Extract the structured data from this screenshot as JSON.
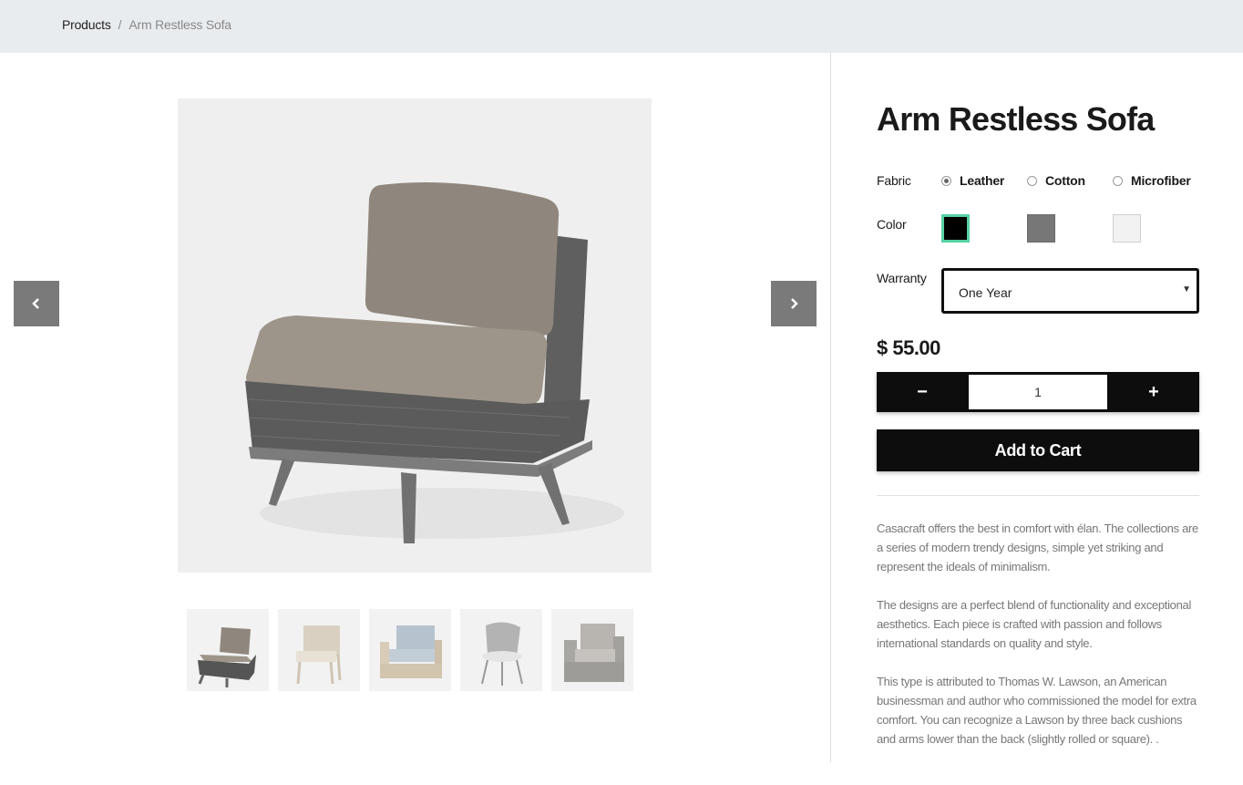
{
  "breadcrumb": {
    "parent": "Products",
    "separator": "/",
    "current": "Arm Restless Sofa"
  },
  "product": {
    "title": "Arm Restless Sofa",
    "fabric_label": "Fabric",
    "fabrics": [
      "Leather",
      "Cotton",
      "Microfiber"
    ],
    "selected_fabric": "Leather",
    "color_label": "Color",
    "colors": [
      "#000000",
      "#777777",
      "#f2f2f2"
    ],
    "selected_color": "#000000",
    "warranty_label": "Warranty",
    "warranty_value": "One Year",
    "price": "$ 55.00",
    "quantity": "1",
    "qty_minus": "−",
    "qty_plus": "+",
    "add_to_cart": "Add to Cart"
  },
  "gallery": {
    "main_image": "gray wicker armless sofa chair with taupe cushions",
    "thumbnails": [
      "gray wicker sofa chair",
      "beige wooden dining chair",
      "light wood armchair with blue cushions",
      "gray wicker lounge chair",
      "gray wicker club chair"
    ]
  },
  "description": [
    "Casacraft offers the best in comfort with élan. The collections are a series of modern trendy designs, simple yet striking and represent the ideals of minimalism.",
    "The designs are a perfect blend of functionality and exceptional aesthetics. Each piece is crafted with passion and follows international standards on quality and style.",
    "This type is attributed to Thomas W. Lawson, an American businessman and author who commissioned the model for extra comfort. You can recognize a Lawson by three back cushions and arms lower than the back (slightly rolled or square). ."
  ],
  "colors": {
    "accent": "#57d1a4",
    "dark": "#0d0d0d",
    "breadcrumb_bg": "#e9ecef",
    "nav_button": "#7a7a7a"
  }
}
